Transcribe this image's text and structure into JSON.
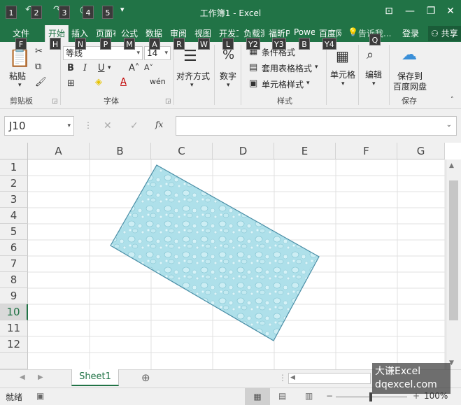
{
  "window": {
    "title": "工作簿1 - Excel",
    "qat_keytips": [
      "1",
      "2",
      "3",
      "4",
      "5"
    ]
  },
  "tabs": [
    {
      "label": "文件",
      "key": "F"
    },
    {
      "label": "开始",
      "key": "H"
    },
    {
      "label": "插入",
      "key": "N"
    },
    {
      "label": "页面布局",
      "key": "P"
    },
    {
      "label": "公式",
      "key": "M"
    },
    {
      "label": "数据",
      "key": "A"
    },
    {
      "label": "审阅",
      "key": "R"
    },
    {
      "label": "视图",
      "key": "W"
    },
    {
      "label": "开发工具",
      "key": "L"
    },
    {
      "label": "负载测试",
      "key": "Y2"
    },
    {
      "label": "福昕PDF",
      "key": "Y3"
    },
    {
      "label": "Power Pivot",
      "key": "B"
    },
    {
      "label": "百度网盘",
      "key": "Y4"
    }
  ],
  "tell_me": "告诉我...",
  "login": "登录",
  "share": "共享",
  "share_key": "Q",
  "ribbon": {
    "clipboard": {
      "paste": "粘贴",
      "group": "剪贴板"
    },
    "font": {
      "name": "等线",
      "size": "14",
      "group": "字体"
    },
    "alignment": {
      "label": "对齐方式"
    },
    "number": {
      "label": "数字"
    },
    "styles": {
      "cond_format": "条件格式",
      "table_format": "套用表格格式",
      "cell_styles": "单元格样式",
      "group": "样式"
    },
    "cells": {
      "label": "单元格"
    },
    "editing": {
      "label": "编辑"
    },
    "save": {
      "label1": "保存到",
      "label2": "百度网盘",
      "group": "保存"
    }
  },
  "formula_bar": {
    "name_box": "J10",
    "fx": "fx",
    "formula": ""
  },
  "columns": [
    "A",
    "B",
    "C",
    "D",
    "E",
    "F",
    "G"
  ],
  "rows": [
    "1",
    "2",
    "3",
    "4",
    "5",
    "6",
    "7",
    "8",
    "9",
    "10",
    "11",
    "12"
  ],
  "active_row": "10",
  "sheet": {
    "name": "Sheet1",
    "add": "⊕"
  },
  "status": {
    "ready": "就绪",
    "zoom": "100%"
  },
  "watermark": {
    "line1": "大谦Excel",
    "line2": "dqexcel.com"
  },
  "colors": {
    "accent": "#217346",
    "shape": "#a8dde6"
  }
}
